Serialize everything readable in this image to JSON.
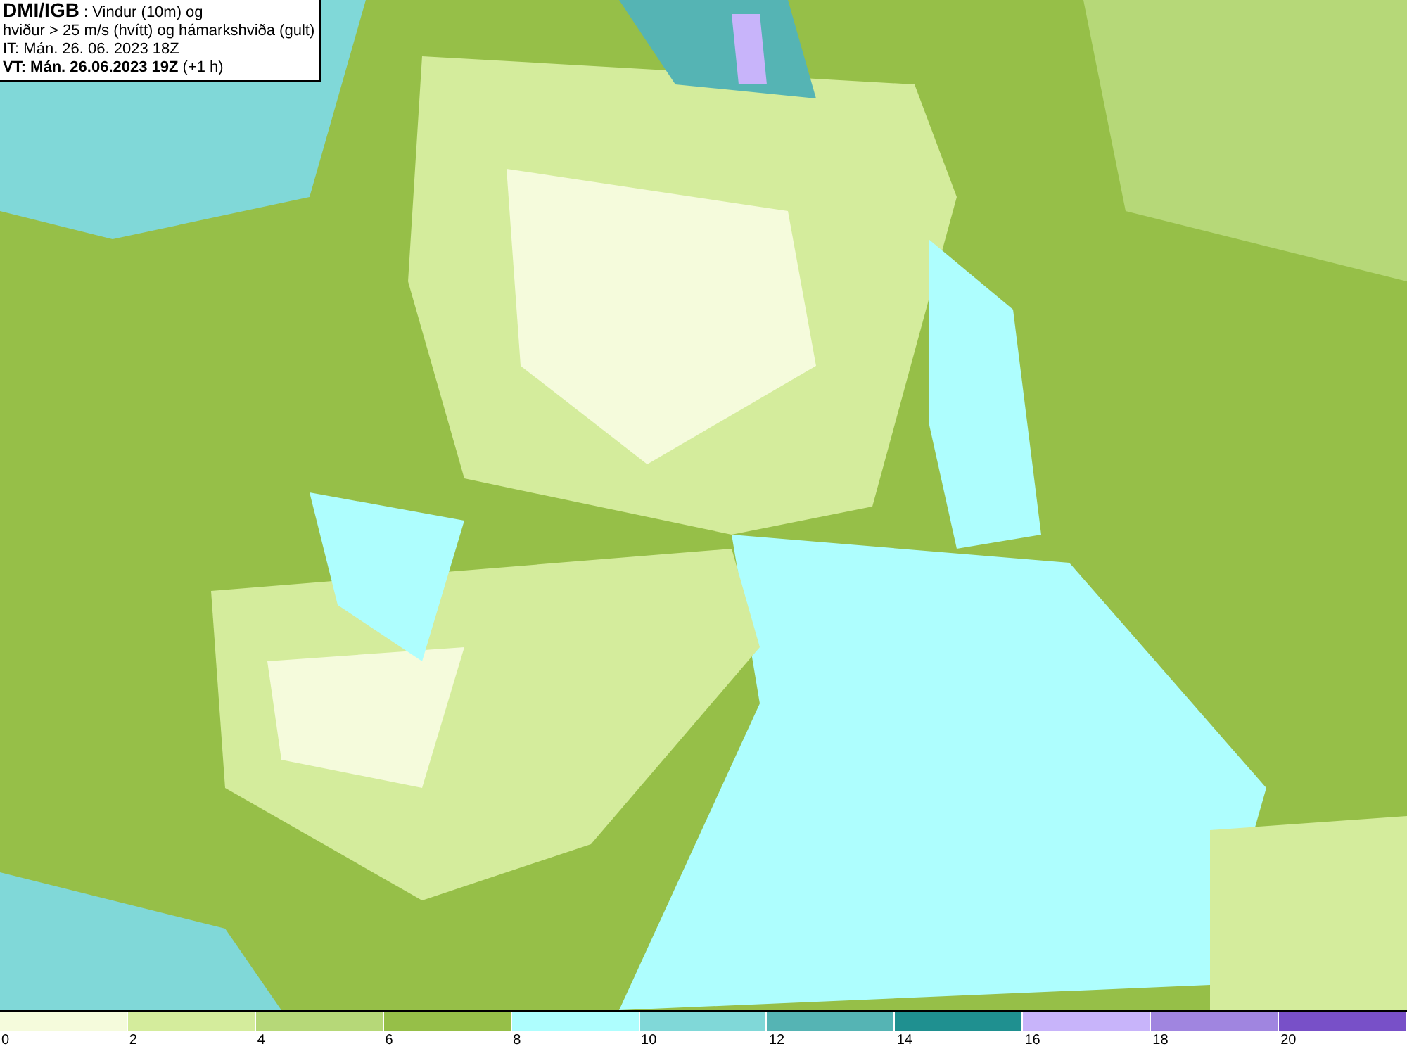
{
  "info_box": {
    "lines": [
      "**DMI/IGB** : Vindur (10m) og",
      "hviður > 25 m/s (hvítt) og hámarkshviða (gult)",
      "IT: Mán. 26. 06. 2023 18Z",
      "**VT: Mán. 26.06.2023 19Z** (+1 h)"
    ]
  },
  "legend": {
    "segments": [
      {
        "label": "0",
        "color": "#f5fbdc"
      },
      {
        "label": "2",
        "color": "#d4ec9c"
      },
      {
        "label": "4",
        "color": "#b6d878"
      },
      {
        "label": "6",
        "color": "#96bf48"
      },
      {
        "label": "8",
        "color": "#aefefe"
      },
      {
        "label": "10",
        "color": "#80d8d8"
      },
      {
        "label": "12",
        "color": "#55b4b4"
      },
      {
        "label": "14",
        "color": "#1f9090"
      },
      {
        "label": "16",
        "color": "#c8b4fa"
      },
      {
        "label": "18",
        "color": "#a085e0"
      },
      {
        "label": "20",
        "color": "#7850c8"
      }
    ]
  }
}
